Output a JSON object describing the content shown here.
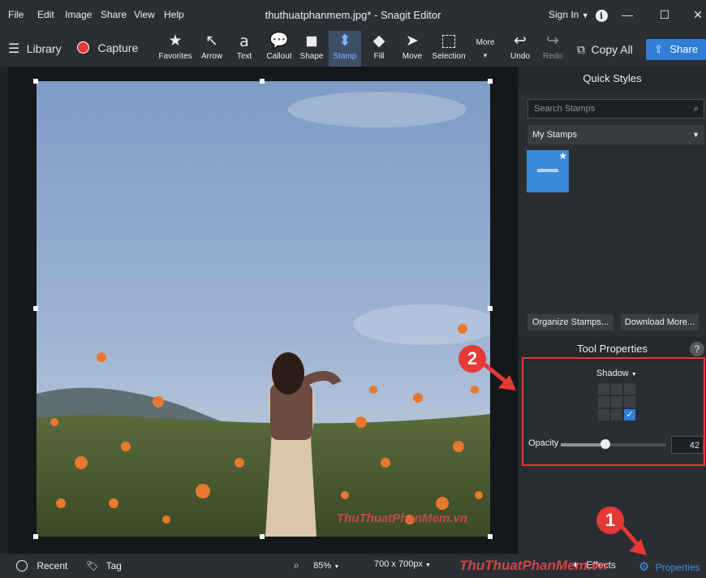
{
  "menu": [
    "File",
    "Edit",
    "Image",
    "Share",
    "View",
    "Help"
  ],
  "window": {
    "title": "thuthuatphanmem.jpg* - Snagit Editor",
    "sign_in": "Sign In"
  },
  "toolbar": {
    "library": "Library",
    "capture": "Capture",
    "tools": [
      {
        "label": "Favorites",
        "icon": "star-icon"
      },
      {
        "label": "Arrow",
        "icon": "arrow-icon"
      },
      {
        "label": "Text",
        "icon": "text-icon"
      },
      {
        "label": "Callout",
        "icon": "callout-icon"
      },
      {
        "label": "Shape",
        "icon": "shape-icon"
      },
      {
        "label": "Stamp",
        "icon": "stamp-icon",
        "active": true
      },
      {
        "label": "Fill",
        "icon": "fill-icon"
      },
      {
        "label": "Move",
        "icon": "move-icon"
      },
      {
        "label": "Selection",
        "icon": "selection-icon"
      }
    ],
    "more": "More",
    "undo": "Undo",
    "redo": "Redo",
    "copy_all": "Copy All",
    "share": "Share"
  },
  "panel": {
    "quick_styles": "Quick Styles",
    "search_placeholder": "Search Stamps",
    "stamps_category": "My Stamps",
    "organize": "Organize Stamps...",
    "download": "Download More...",
    "tool_properties": "Tool Properties",
    "help": "?",
    "shadow_label": "Shadow",
    "opacity_label": "Opacity",
    "opacity_value": "42",
    "opacity_level": 0.42
  },
  "bottom": {
    "recent": "Recent",
    "tag": "Tag",
    "zoom": "85%",
    "size": "700 x 700px",
    "effects": "Effects",
    "properties": "Properties"
  },
  "annotations": {
    "badge1": "1",
    "badge2": "2"
  },
  "watermark": "ThuThuatPhanMem.vn",
  "colors": {
    "accent": "#2f7fd6",
    "active_tool": "#7fb3ff",
    "annotation": "#e53935"
  }
}
